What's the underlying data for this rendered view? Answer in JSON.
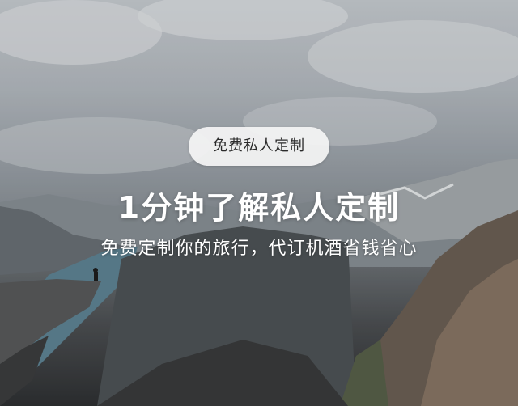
{
  "hero": {
    "badge_label": "免费私人定制",
    "title": "1分钟了解私人定制",
    "subtitle": "免费定制你的旅行，代订机酒省钱省心"
  }
}
